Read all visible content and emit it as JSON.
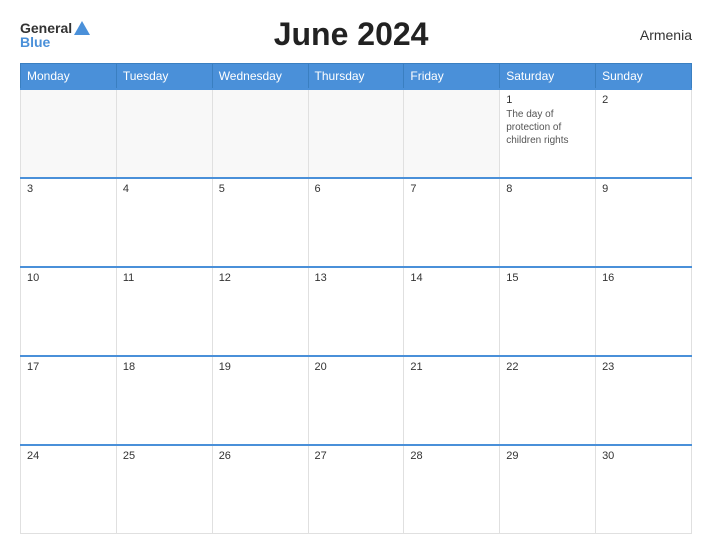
{
  "header": {
    "logo_general": "General",
    "logo_blue": "Blue",
    "title": "June 2024",
    "country": "Armenia"
  },
  "calendar": {
    "days_of_week": [
      "Monday",
      "Tuesday",
      "Wednesday",
      "Thursday",
      "Friday",
      "Saturday",
      "Sunday"
    ],
    "weeks": [
      [
        {
          "day": "",
          "empty": true
        },
        {
          "day": "",
          "empty": true
        },
        {
          "day": "",
          "empty": true
        },
        {
          "day": "",
          "empty": true
        },
        {
          "day": "",
          "empty": true
        },
        {
          "day": "1",
          "event": "The day of protection of children rights"
        },
        {
          "day": "2"
        }
      ],
      [
        {
          "day": "3"
        },
        {
          "day": "4"
        },
        {
          "day": "5"
        },
        {
          "day": "6"
        },
        {
          "day": "7"
        },
        {
          "day": "8"
        },
        {
          "day": "9"
        }
      ],
      [
        {
          "day": "10"
        },
        {
          "day": "11"
        },
        {
          "day": "12"
        },
        {
          "day": "13"
        },
        {
          "day": "14"
        },
        {
          "day": "15"
        },
        {
          "day": "16"
        }
      ],
      [
        {
          "day": "17"
        },
        {
          "day": "18"
        },
        {
          "day": "19"
        },
        {
          "day": "20"
        },
        {
          "day": "21"
        },
        {
          "day": "22"
        },
        {
          "day": "23"
        }
      ],
      [
        {
          "day": "24"
        },
        {
          "day": "25"
        },
        {
          "day": "26"
        },
        {
          "day": "27"
        },
        {
          "day": "28"
        },
        {
          "day": "29"
        },
        {
          "day": "30"
        }
      ]
    ]
  }
}
